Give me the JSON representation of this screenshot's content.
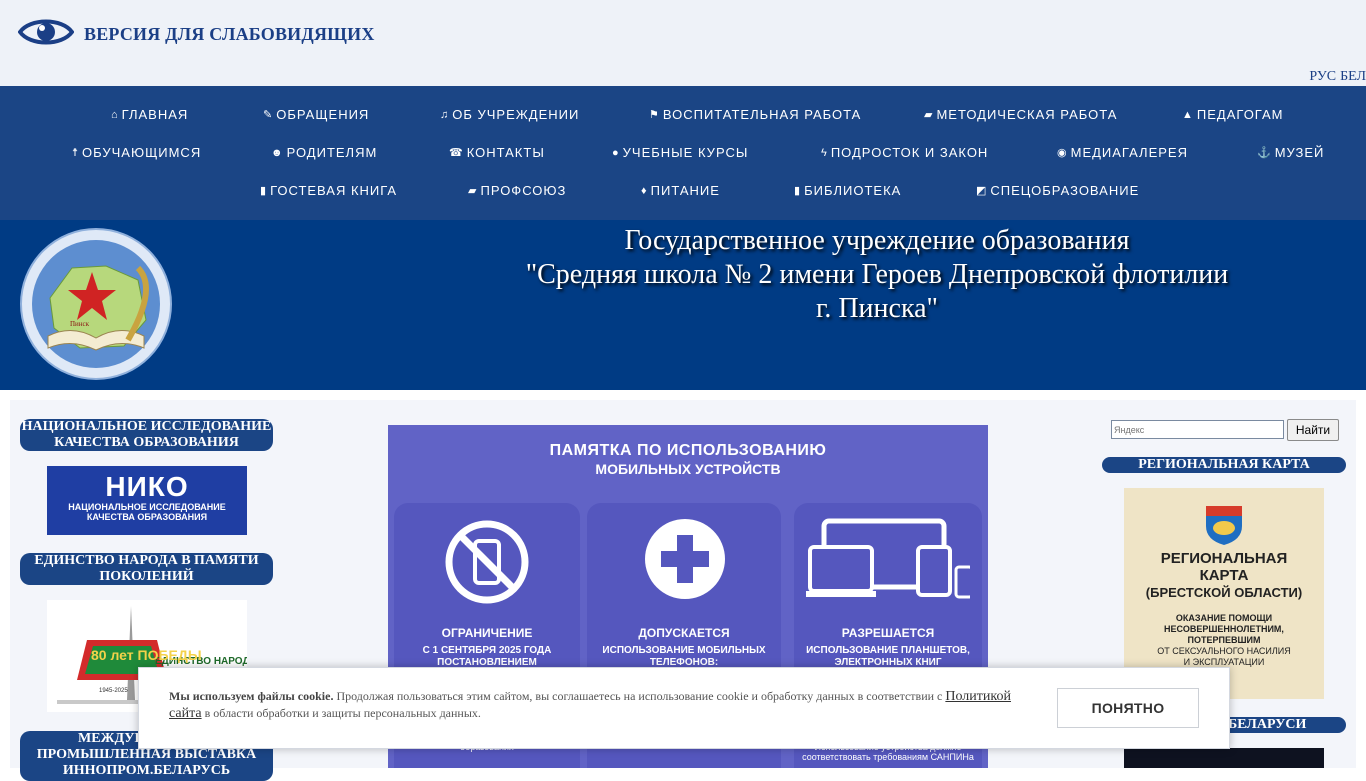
{
  "topbar": {
    "vision_label": "ВЕРСИЯ ДЛЯ СЛАБОВИДЯЩИХ",
    "languages": [
      "РУС",
      "БЕЛ"
    ]
  },
  "nav": {
    "row1": [
      {
        "label": "ГЛАВНАЯ",
        "icon": "home-icon"
      },
      {
        "label": "ОБРАЩЕНИЯ",
        "icon": "pencil-icon"
      },
      {
        "label": "ОБ УЧРЕЖДЕНИИ",
        "icon": "bell-icon"
      },
      {
        "label": "ВОСПИТАТЕЛЬНАЯ РАБОТА",
        "icon": "flag-icon"
      },
      {
        "label": "МЕТОДИЧЕСКАЯ РАБОТА",
        "icon": "folder-icon"
      },
      {
        "label": "ПЕДАГОГАМ",
        "icon": "graduation-cap-icon"
      }
    ],
    "row2": [
      {
        "label": "ОБУЧАЮЩИМСЯ",
        "icon": "child-icon"
      },
      {
        "label": "РОДИТЕЛЯМ",
        "icon": "users-icon"
      },
      {
        "label": "КОНТАКТЫ",
        "icon": "phone-icon"
      },
      {
        "label": "УЧЕБНЫЕ КУРСЫ",
        "icon": "globe-icon"
      },
      {
        "label": "ПОДРОСТОК И ЗАКОН",
        "icon": "bolt-icon"
      },
      {
        "label": "МЕДИАГАЛЕРЕЯ",
        "icon": "play-circle-icon"
      },
      {
        "label": "МУЗЕЙ",
        "icon": "anchor-icon"
      }
    ],
    "row3": [
      {
        "label": "ГОСТЕВАЯ КНИГА",
        "icon": "book-icon"
      },
      {
        "label": "ПРОФСОЮЗ",
        "icon": "folder-open-icon"
      },
      {
        "label": "ПИТАНИЕ",
        "icon": "tint-icon"
      },
      {
        "label": "БИБЛИОТЕКА",
        "icon": "book-icon"
      },
      {
        "label": "СПЕЦОБРАЗОВАНИЕ",
        "icon": "edit-icon"
      }
    ]
  },
  "banner": {
    "title_line1": "Государственное учреждение образования",
    "title_line2": "\"Средняя школа № 2 имени Героев Днепровской флотилии",
    "title_line3": "г. Пинска\"",
    "emblem_caption": "Пинск"
  },
  "left_sidebar": {
    "niko_heading": "НАЦИОНАЛЬНОЕ ИССЛЕДОВАНИЕ КАЧЕСТВА ОБРАЗОВАНИЯ",
    "niko_logo_big": "НИКО",
    "niko_logo_small1": "НАЦИОНАЛЬНОЕ ИССЛЕДОВАНИЕ",
    "niko_logo_small2": "КАЧЕСТВА ОБРАЗОВАНИЯ",
    "unity_heading": "ЕДИНСТВО НАРОДА В ПАМЯТИ ПОКОЛЕНИЙ",
    "unity_logo_text": "ЕДИНСТВО НАРОДА",
    "unity_badge": "80 лет ПОБЕДЫ",
    "unity_years": "1945-2025",
    "expo_heading": "МЕЖДУНАРОДНАЯ ПРОМЫШЛЕННАЯ ВЫСТАВКА ИННОПРОМ.БЕЛАРУСЬ"
  },
  "poster": {
    "heading1": "ПАМЯТКА ПО ИСПОЛЬЗОВАНИЮ",
    "heading2": "МОБИЛЬНЫХ УСТРОЙСТВ",
    "cards": [
      {
        "title": "ОГРАНИЧЕНИЕ",
        "body": "С 1 СЕНТЯБРЯ 2025 ГОДА ПОСТАНОВЛЕНИЕМ",
        "footer": "образования"
      },
      {
        "title": "ДОПУСКАЕТСЯ",
        "body": "ИСПОЛЬЗОВАНИЕ МОБИЛЬНЫХ ТЕЛЕФОНОВ:",
        "footer": ""
      },
      {
        "title": "РАЗРЕШАЕТСЯ",
        "body": "ИСПОЛЬЗОВАНИЕ ПЛАНШЕТОВ, ЭЛЕКТРОННЫХ КНИГ",
        "footer": "Использование устройства должно соответствовать требованиям САНПИНа"
      }
    ]
  },
  "right_sidebar": {
    "search_placeholder": "Яндекс",
    "search_button": "Найти",
    "regional_heading": "РЕГИОНАЛЬНАЯ КАРТА",
    "regional_title1": "РЕГИОНАЛЬНАЯ",
    "regional_title2": "КАРТА",
    "regional_title3": "(БРЕСТСКОЙ ОБЛАСТИ)",
    "regional_sub1": "ОКАЗАНИЕ ПОМОЩИ",
    "regional_sub2": "НЕСОВЕРШЕННОЛЕТНИМ,",
    "regional_sub3": "ПОТЕРПЕВШИМ",
    "regional_sub4": "ОТ СЕКСУАЛЬНОГО НАСИЛИЯ",
    "regional_sub5": "И ЭКСПЛУАТАЦИИ",
    "belarus_heading": "БЕЛАРУСИ"
  },
  "cookie": {
    "bold": "Мы используем файлы cookie.",
    "text1": "Продолжая пользоваться этим сайтом, вы соглашаетесь на использование cookie и обработку данных в соответствии с",
    "link": "Политикой сайта",
    "text2": "в области обработки и защиты персональных данных.",
    "button": "ПОНЯТНО"
  },
  "colors": {
    "nav_bg": "#1b4585",
    "banner_bg": "#003b84",
    "topbar_bg": "#eef2f8",
    "poster_bg": "#6163c6"
  }
}
